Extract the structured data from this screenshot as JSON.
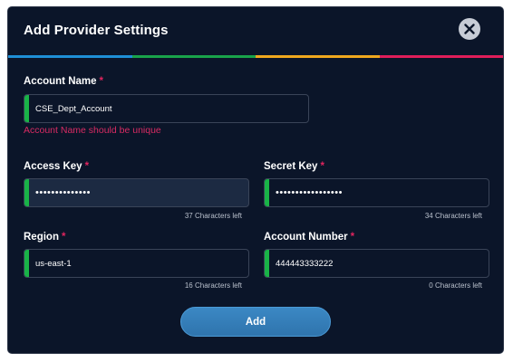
{
  "dialog": {
    "title": "Add Provider Settings",
    "close_icon": "close-icon",
    "stripe_colors": [
      "#1e8fd6",
      "#19a34a",
      "#f0a81e",
      "#e01e5a"
    ]
  },
  "account_name": {
    "label": "Account Name",
    "required_mark": "*",
    "value": "CSE_Dept_Account",
    "error": "Account Name should be unique"
  },
  "access_key": {
    "label": "Access Key",
    "required_mark": "*",
    "value": "••••••••••••••",
    "counter": "37 Characters left"
  },
  "secret_key": {
    "label": "Secret Key",
    "required_mark": "*",
    "value": "•••••••••••••••••",
    "counter": "34 Characters left"
  },
  "region": {
    "label": "Region",
    "required_mark": "*",
    "value": "us-east-1",
    "counter": "16 Characters left"
  },
  "account_number": {
    "label": "Account Number",
    "required_mark": "*",
    "value": "444443333222",
    "counter": "0 Characters left"
  },
  "actions": {
    "add_label": "Add"
  },
  "colors": {
    "background": "#0b1529",
    "accent": "#2f74ad",
    "required": "#e0245e",
    "valid_bar": "#19b347"
  }
}
